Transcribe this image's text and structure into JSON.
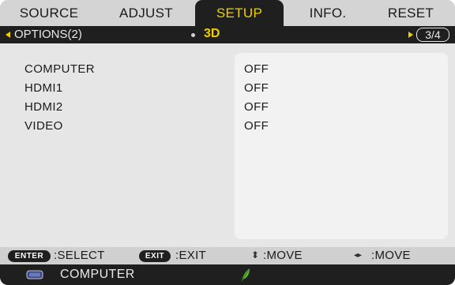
{
  "tabs": [
    {
      "label": "SOURCE",
      "active": false
    },
    {
      "label": "ADJUST",
      "active": false
    },
    {
      "label": "SETUP",
      "active": true
    },
    {
      "label": "INFO.",
      "active": false
    },
    {
      "label": "RESET",
      "active": false
    }
  ],
  "subheader": {
    "prev_label": "OPTIONS(2)",
    "current_label": "3D",
    "page_indicator": "3/4"
  },
  "rows": [
    {
      "label": "COMPUTER",
      "value": "OFF"
    },
    {
      "label": "HDMI1",
      "value": "OFF"
    },
    {
      "label": "HDMI2",
      "value": "OFF"
    },
    {
      "label": "VIDEO",
      "value": "OFF"
    }
  ],
  "help": {
    "enter_key": "ENTER",
    "select_text": ":SELECT",
    "exit_key": "EXIT",
    "exit_text": ":EXIT",
    "move_updown_text": ":MOVE",
    "move_leftright_text": ":MOVE"
  },
  "status": {
    "source_label": "COMPUTER",
    "source_icon": "monitor-icon",
    "eco_icon": "eco-leaf-icon"
  },
  "colors": {
    "accent": "#f0d000",
    "bar_dark": "#1f1f1f",
    "leaf_green": "#5cb82e"
  }
}
